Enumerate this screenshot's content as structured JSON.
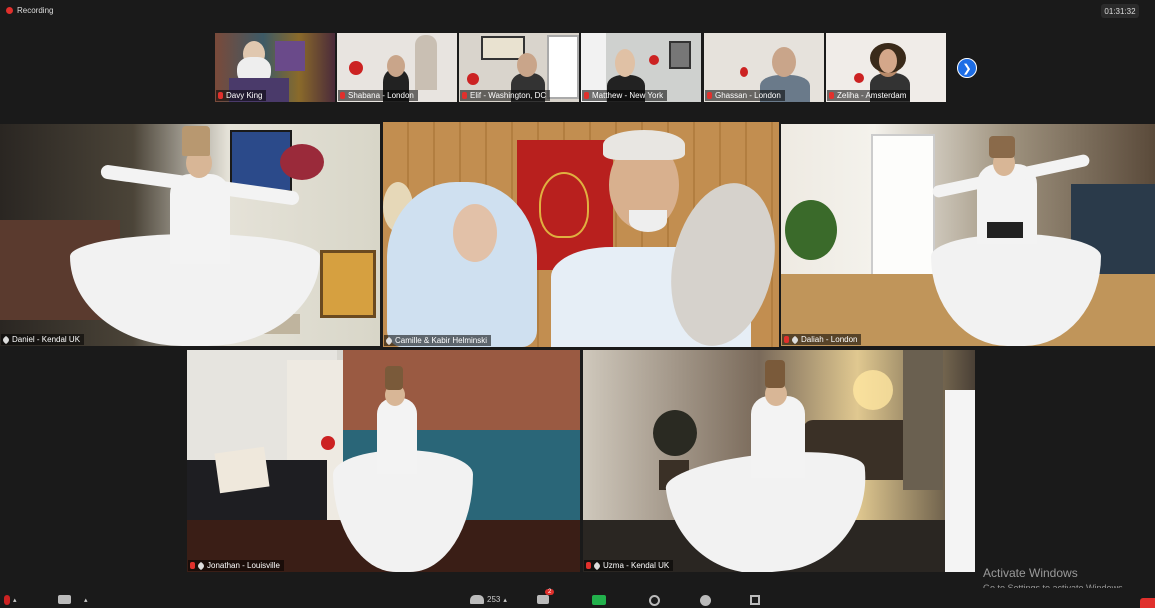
{
  "meeting": {
    "recording_label": "Recording",
    "elapsed_time": "01:31:32"
  },
  "thumbnails": [
    {
      "name": "Davy King"
    },
    {
      "name": "Shabana - London"
    },
    {
      "name": "Elif - Washington, DC"
    },
    {
      "name": "Matthew - New York"
    },
    {
      "name": "Ghassan - London"
    },
    {
      "name": "Zeliha - Amsterdam"
    }
  ],
  "next_page_icon": "chevron-right-icon",
  "tiles": [
    {
      "name": "Daniel - Kendal UK"
    },
    {
      "name": "Camille & Kabir Helminski"
    },
    {
      "name": "Daliah - London"
    },
    {
      "name": "Jonathan - Louisville"
    },
    {
      "name": "Uzma - Kendal UK"
    }
  ],
  "toolbar": {
    "participants_count": "253",
    "chat_badge": "2",
    "icons": [
      "mic-icon",
      "video-icon",
      "participants-icon",
      "chat-icon",
      "share-icon",
      "record-icon",
      "reactions-icon",
      "apps-icon"
    ]
  },
  "watermark": {
    "title": "Activate Windows",
    "subtitle": "Go to Settings to activate Windows."
  },
  "colors": {
    "active_speaker_border": "#c9e34a",
    "recording_red": "#e0302c",
    "accent_blue": "#1d6de5",
    "share_green": "#22b14c"
  }
}
